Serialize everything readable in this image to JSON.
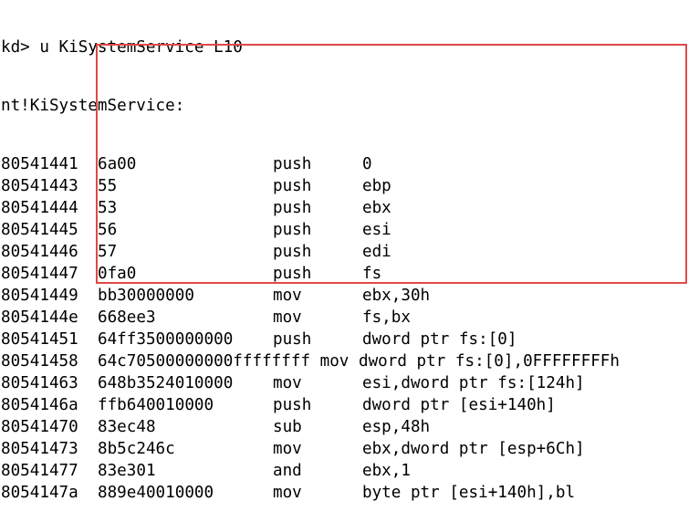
{
  "command": "kd> u KiSystemService L10",
  "symbol": "nt!KiSystemService:",
  "highlight_color": "#e04848",
  "rows": [
    {
      "addr": "80541441",
      "bytes": "6a00",
      "mnem": "push",
      "ops": "0"
    },
    {
      "addr": "80541443",
      "bytes": "55",
      "mnem": "push",
      "ops": "ebp"
    },
    {
      "addr": "80541444",
      "bytes": "53",
      "mnem": "push",
      "ops": "ebx"
    },
    {
      "addr": "80541445",
      "bytes": "56",
      "mnem": "push",
      "ops": "esi"
    },
    {
      "addr": "80541446",
      "bytes": "57",
      "mnem": "push",
      "ops": "edi"
    },
    {
      "addr": "80541447",
      "bytes": "0fa0",
      "mnem": "push",
      "ops": "fs"
    },
    {
      "addr": "80541449",
      "bytes": "bb30000000",
      "mnem": "mov",
      "ops": "ebx,30h"
    },
    {
      "addr": "8054144e",
      "bytes": "668ee3",
      "mnem": "mov",
      "ops": "fs,bx"
    },
    {
      "addr": "80541451",
      "bytes": "64ff3500000000",
      "mnem": "push",
      "ops": "dword ptr fs:[0]"
    },
    {
      "addr": "80541458",
      "bytes": "64c70500000000ffffffff mov dword ptr fs:[0],0FFFFFFFFh",
      "mnem": "",
      "ops": ""
    },
    {
      "addr": "80541463",
      "bytes": "648b3524010000",
      "mnem": "mov",
      "ops": "esi,dword ptr fs:[124h]"
    },
    {
      "addr": "8054146a",
      "bytes": "ffb640010000",
      "mnem": "push",
      "ops": "dword ptr [esi+140h]"
    },
    {
      "addr": "80541470",
      "bytes": "83ec48",
      "mnem": "sub",
      "ops": "esp,48h"
    },
    {
      "addr": "80541473",
      "bytes": "8b5c246c",
      "mnem": "mov",
      "ops": "ebx,dword ptr [esp+6Ch]"
    },
    {
      "addr": "80541477",
      "bytes": "83e301",
      "mnem": "and",
      "ops": "ebx,1"
    },
    {
      "addr": "8054147a",
      "bytes": "889e40010000",
      "mnem": "mov",
      "ops": "byte ptr [esi+140h],bl"
    }
  ]
}
